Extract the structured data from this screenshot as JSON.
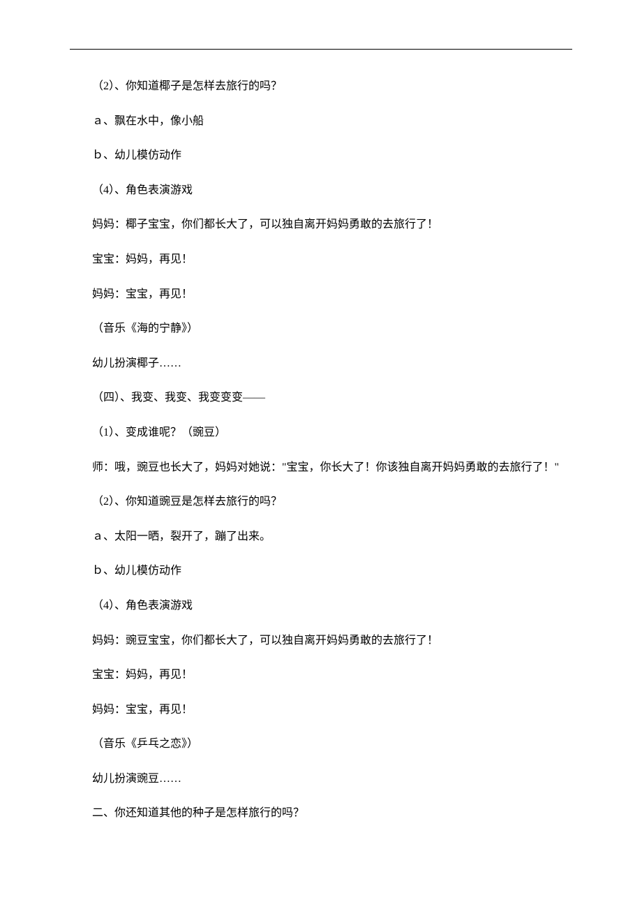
{
  "lines": {
    "l1": "（2）、你知道椰子是怎样去旅行的吗？",
    "l2": "ａ、飘在水中，像小船",
    "l3": "ｂ、幼儿模仿动作",
    "l4": "（4）、角色表演游戏",
    "l5": "妈妈：椰子宝宝，你们都长大了，可以独自离开妈妈勇敢的去旅行了！",
    "l6": "宝宝：妈妈，再见！",
    "l7": "妈妈：宝宝，再见！",
    "l8": "（音乐《海的宁静》）",
    "l9": "幼儿扮演椰子……",
    "l10": "（四）、我变、我变、我变变变——",
    "l11": "（1）、变成谁呢？（豌豆）",
    "l12": "师：哦，豌豆也长大了，妈妈对她说：\"宝宝，你长大了！你该独自离开妈妈勇敢的去旅行了！\"",
    "l13": "（2）、你知道豌豆是怎样去旅行的吗？",
    "l14": "ａ、太阳一晒，裂开了，蹦了出来。",
    "l15": "ｂ、幼儿模仿动作",
    "l16": "（4）、角色表演游戏",
    "l17": "妈妈：豌豆宝宝，你们都长大了，可以独自离开妈妈勇敢的去旅行了！",
    "l18": "宝宝：妈妈，再见！",
    "l19": "妈妈：宝宝，再见！",
    "l20": "（音乐《乒乓之恋》）",
    "l21": "幼儿扮演豌豆……",
    "l22": "二、你还知道其他的种子是怎样旅行的吗？"
  }
}
